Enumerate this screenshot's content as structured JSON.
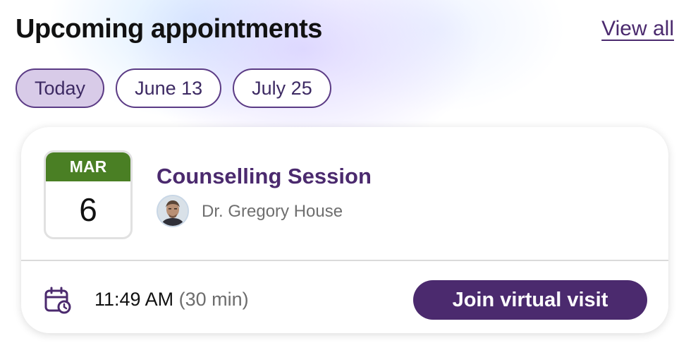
{
  "header": {
    "title": "Upcoming appointments",
    "view_all_label": "View all"
  },
  "filters": [
    {
      "label": "Today",
      "active": true
    },
    {
      "label": "June 13",
      "active": false
    },
    {
      "label": "July 25",
      "active": false
    }
  ],
  "appointment": {
    "month": "MAR",
    "day": "6",
    "title": "Counselling Session",
    "doctor": "Dr. Gregory House",
    "time": "11:49 AM",
    "duration": "(30 min)",
    "join_label": "Join virtual visit"
  },
  "colors": {
    "accent": "#4b2a6e",
    "chip_active_bg": "#d8cbe8",
    "month_header": "#4a7f24"
  },
  "icons": {
    "calendar": "calendar-clock-icon",
    "avatar": "doctor-avatar"
  }
}
